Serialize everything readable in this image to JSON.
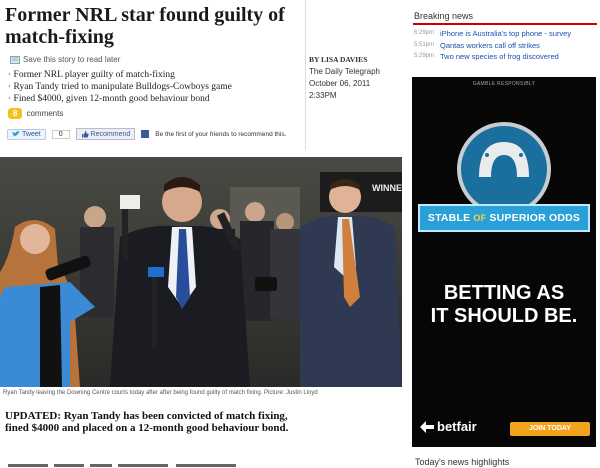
{
  "article": {
    "title": "Former NRL star found guilty of match-fixing",
    "save_label": "Save this story to read later",
    "bullets": [
      "Former NRL player guilty of match-fixing",
      "Ryan Tandy tried to manipulate Bulldogs-Cowboys game",
      "Fined $4000, given 12-month good behaviour bond"
    ],
    "comments_count": "8",
    "comments_label": "comments",
    "tweet_label": "Tweet",
    "tweet_count": "0",
    "recommend_label": "Recommend",
    "fb_text": "Be the first of your friends to recommend this.",
    "byline": {
      "author": "BY LISA DAVIES",
      "outlet": "The Daily Telegraph",
      "date": "October 06, 2011",
      "time": "2:33PM"
    },
    "caption": "Ryan Tandy leaving the Downing Centre courts today after after being found guilty of match fixing. Picture: Justin Lloyd",
    "updated_text": "UPDATED: Ryan Tandy has been convicted of match fixing, fined $4000 and placed on a 12-month good behaviour bond.",
    "photo_sign": "WINNER"
  },
  "breaking_news": {
    "title": "Breaking news",
    "items": [
      {
        "time": "6:29pm",
        "headline": "iPhone is Australia's top phone - survey"
      },
      {
        "time": "5:51pm",
        "headline": "Qantas workers call off strikes"
      },
      {
        "time": "5:29pm",
        "headline": "Two new species of frog discovered"
      }
    ]
  },
  "ad": {
    "responsibly": "GAMBLE RESPONSIBLY",
    "stable_pre": "STABLE ",
    "stable_of": "OF",
    "stable_post": " SUPERIOR ODDS",
    "slogan_line1": "BETTING AS",
    "slogan_line2": "IT SHOULD BE.",
    "brand": "betfair",
    "cta": "JOIN TODAY"
  },
  "today_highlights": "Today's news highlights",
  "colors": {
    "breaking_rule": "#cc0000",
    "link_blue": "#1a4fb0",
    "ad_blue": "#2aa0d8",
    "ad_orange": "#f2a31c",
    "comment_badge": "#f5c21b"
  }
}
